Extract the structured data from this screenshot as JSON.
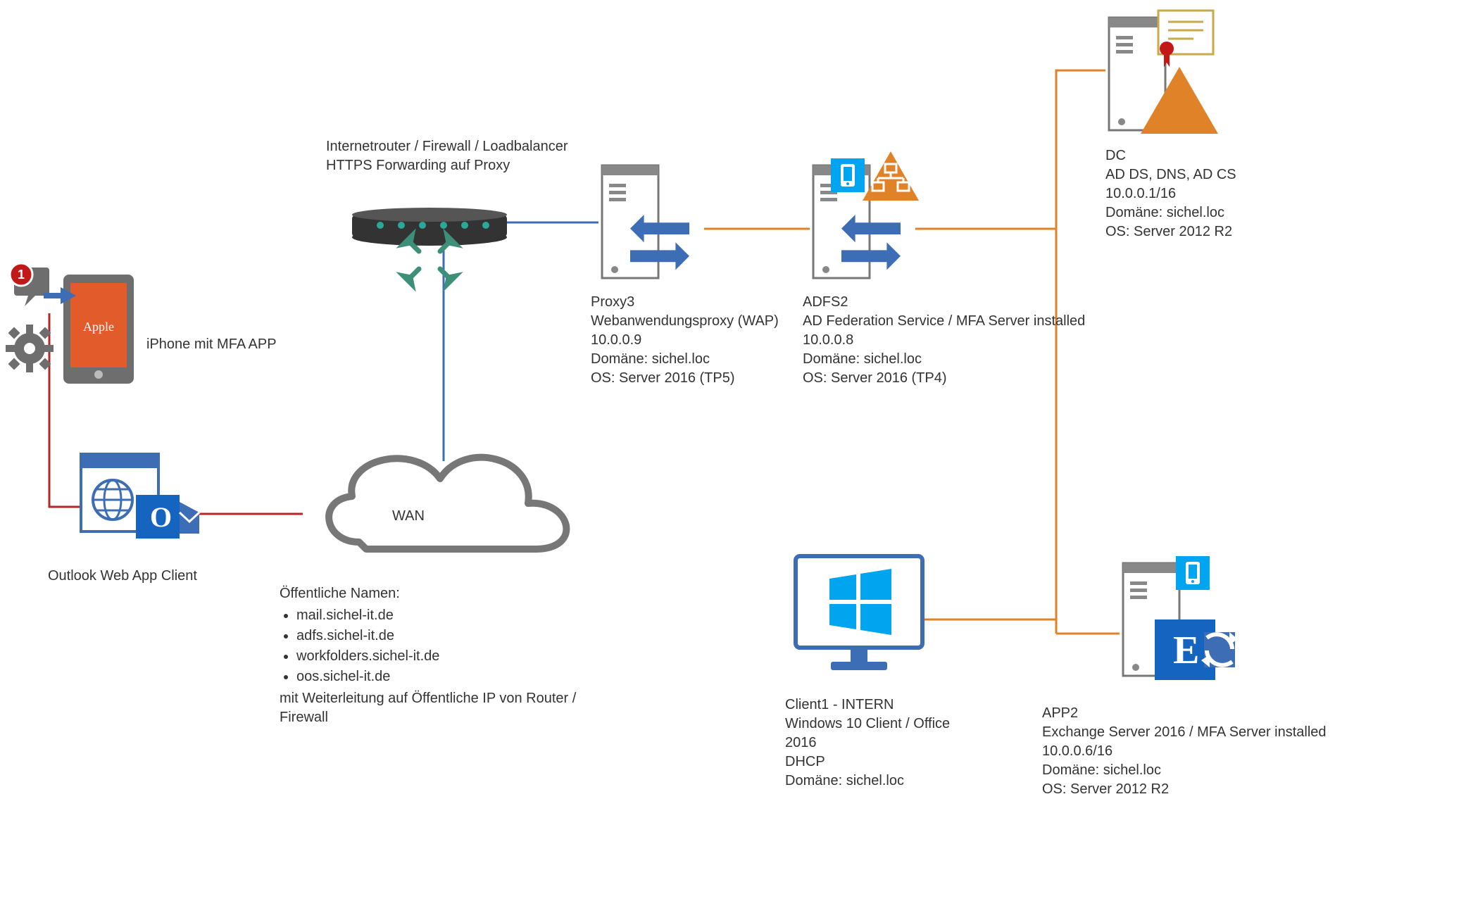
{
  "iphone": {
    "label": "iPhone mit MFA APP",
    "device_brand": "Apple",
    "badge": "1"
  },
  "owa": {
    "label": "Outlook Web App Client"
  },
  "wan": {
    "label": "WAN",
    "public_names_heading": "Öffentliche Namen:",
    "public_names": [
      "mail.sichel-it.de",
      "adfs.sichel-it.de",
      "workfolders.sichel-it.de",
      "oos.sichel-it.de"
    ],
    "forwarding_note": "mit Weiterleitung auf Öffentliche IP von Router / Firewall"
  },
  "router": {
    "line1": "Internetrouter / Firewall / Loadbalancer",
    "line2": "HTTPS Forwarding auf Proxy"
  },
  "proxy": {
    "name": "Proxy3",
    "role": "Webanwendungsproxy (WAP)",
    "ip": "10.0.0.9",
    "domain": "Domäne: sichel.loc",
    "os": "OS: Server 2016 (TP5)"
  },
  "adfs": {
    "name": "ADFS2",
    "role": "AD Federation Service / MFA Server installed",
    "ip": "10.0.0.8",
    "domain": "Domäne: sichel.loc",
    "os": "OS: Server 2016 (TP4)"
  },
  "dc": {
    "name": "DC",
    "role": "AD DS, DNS, AD CS",
    "ip": "10.0.0.1/16",
    "domain": "Domäne: sichel.loc",
    "os": "OS: Server 2012 R2"
  },
  "client": {
    "name": "Client1 - INTERN",
    "role": "Windows 10 Client / Office 2016",
    "ip": "DHCP",
    "domain": "Domäne: sichel.loc"
  },
  "app2": {
    "name": "APP2",
    "role": "Exchange Server 2016 / MFA Server installed",
    "ip": "10.0.0.6/16",
    "domain": "Domäne: sichel.loc",
    "os": "OS: Server 2012 R2"
  },
  "colors": {
    "blue": "#3d6db5",
    "orange": "#e08227",
    "red": "#b02a2a",
    "cyan": "#00a4ef"
  }
}
